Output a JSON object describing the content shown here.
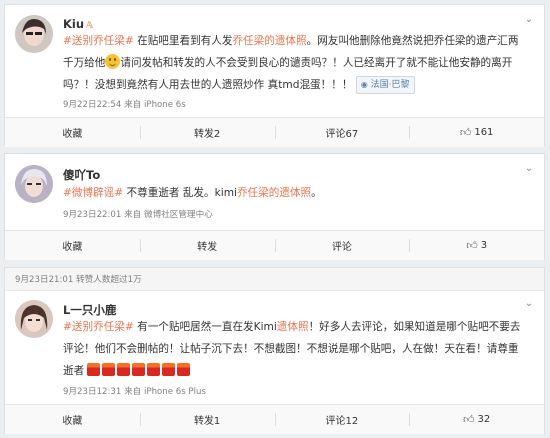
{
  "posts": [
    {
      "user": "Kiu",
      "user_mark": "𝔸",
      "line1_parts": [
        "#送别乔任梁#",
        " 在贴吧里看到有人发",
        "乔任梁的",
        "遗体照",
        "。网友叫他删除他竟然说把乔任梁的遗产汇两"
      ],
      "line2_a": "千万给他",
      "line2_b": "请问发帖和转发的人不会受到良心的谴责吗？！人已经离开了就不能让他安静的离开",
      "line3": "吗？！没想到竟然有人用去世的人遗照炒作 真tmd混蛋！！！",
      "location": "法国·巴黎",
      "meta": "9月22日22:54 来自 iPhone 6s",
      "actions": {
        "fav": "收藏",
        "repost": "转发2",
        "comment": "评论67",
        "like": "161"
      }
    },
    {
      "user": "傻吖To",
      "text_tag": "#微博辟谣#",
      "text_a": " 不尊重逝者 乱发。kimi",
      "text_b": "乔任梁的遗体照",
      "text_c": "。",
      "meta": "9月23日22:01 来自 微博社区管理中心",
      "actions": {
        "fav": "收藏",
        "repost": "转发",
        "comment": "评论",
        "like": "3"
      }
    },
    {
      "repost_head": "9月23日21:01  转赞人数超过1万",
      "user": "L一只小鹿",
      "line1_tag": "#送别乔任梁#",
      "line1_a": " 有一个贴吧居然一直在发Kimi",
      "line1_b": "遗体照",
      "line1_c": "！好多人去评论，如果知道是哪个贴吧不要去",
      "line2": "评论！他们不会删帖的！让帖子沉下去！不想截图！不想说是哪个贴吧，人在做！天在看！请尊重",
      "line3": "逝者",
      "meta": "9月23日12:31 来自 iPhone 6s Plus",
      "actions": {
        "fav": "收藏",
        "repost": "转发1",
        "comment": "评论12",
        "like": "32"
      }
    }
  ],
  "colors": {
    "accent": "#eb7350",
    "link": "#5d7fa8"
  }
}
